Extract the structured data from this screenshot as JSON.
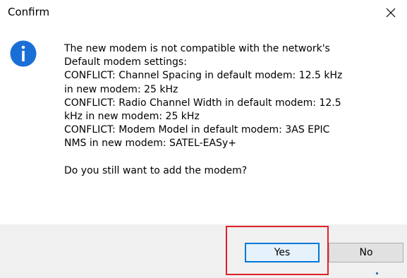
{
  "window": {
    "title": "Confirm"
  },
  "message": {
    "lines": [
      "The new modem is not compatible with the network's",
      "Default modem settings:",
      "CONFLICT: Channel Spacing in default modem: 12.5 kHz",
      "in new modem: 25 kHz",
      "CONFLICT: Radio Channel Width in default modem: 12.5",
      "kHz in new modem: 25 kHz",
      "CONFLICT: Modem Model in default modem: 3AS EPIC",
      "NMS in new modem: SATEL-EASy+"
    ],
    "question": "Do you still want to add the modem?"
  },
  "buttons": {
    "yes_label": "Yes",
    "no_label": "No"
  },
  "icons": {
    "dialog": "info-icon",
    "close": "close-icon"
  },
  "colors": {
    "info_icon": "#1a6fd6",
    "default_button_border": "#0078d7",
    "highlight": "#e0202a"
  }
}
